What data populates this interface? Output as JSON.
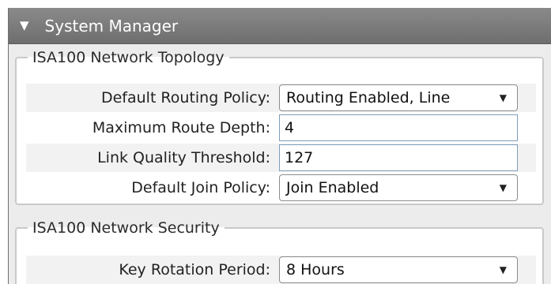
{
  "panel": {
    "title": "System Manager",
    "collapse_glyph": "▼"
  },
  "topology": {
    "legend": "ISA100 Network Topology",
    "routing_policy_label": "Default Routing Policy:",
    "routing_policy_value": "Routing Enabled, Line",
    "max_route_depth_label": "Maximum Route Depth:",
    "max_route_depth_value": "4",
    "link_quality_label": "Link Quality Threshold:",
    "link_quality_value": "127",
    "join_policy_label": "Default Join Policy:",
    "join_policy_value": "Join Enabled"
  },
  "security": {
    "legend": "ISA100 Network Security",
    "key_rotation_label": "Key Rotation Period:",
    "key_rotation_value": "8 Hours"
  },
  "dropdown_glyph": "▼",
  "colors": {
    "header_bg": "#7d7d7d",
    "panel_bg": "#ececec",
    "field_border": "#7f9db9"
  }
}
